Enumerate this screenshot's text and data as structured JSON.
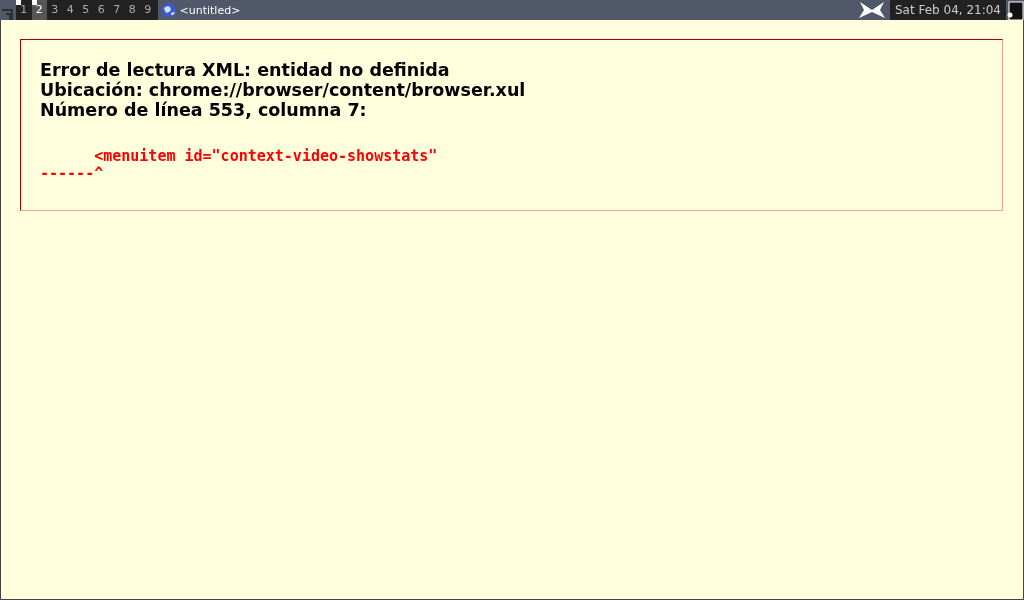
{
  "taskbar": {
    "workspaces": [
      {
        "label": "1",
        "selected": false,
        "occupied": true
      },
      {
        "label": "2",
        "selected": true,
        "occupied": true
      },
      {
        "label": "3",
        "selected": false,
        "occupied": false
      },
      {
        "label": "4",
        "selected": false,
        "occupied": false
      },
      {
        "label": "5",
        "selected": false,
        "occupied": false
      },
      {
        "label": "6",
        "selected": false,
        "occupied": false
      },
      {
        "label": "7",
        "selected": false,
        "occupied": false
      },
      {
        "label": "8",
        "selected": false,
        "occupied": false
      },
      {
        "label": "9",
        "selected": false,
        "occupied": false
      }
    ],
    "window_title": "<untitled>",
    "clock": "Sat Feb 04, 21:04"
  },
  "error": {
    "lines": [
      "Error de lectura XML: entidad no definida",
      "Ubicación: chrome://browser/content/browser.xul",
      "Número de línea 553, columna 7:"
    ],
    "source": [
      "      <menuitem id=\"context-video-showstats\"",
      "------^"
    ]
  }
}
